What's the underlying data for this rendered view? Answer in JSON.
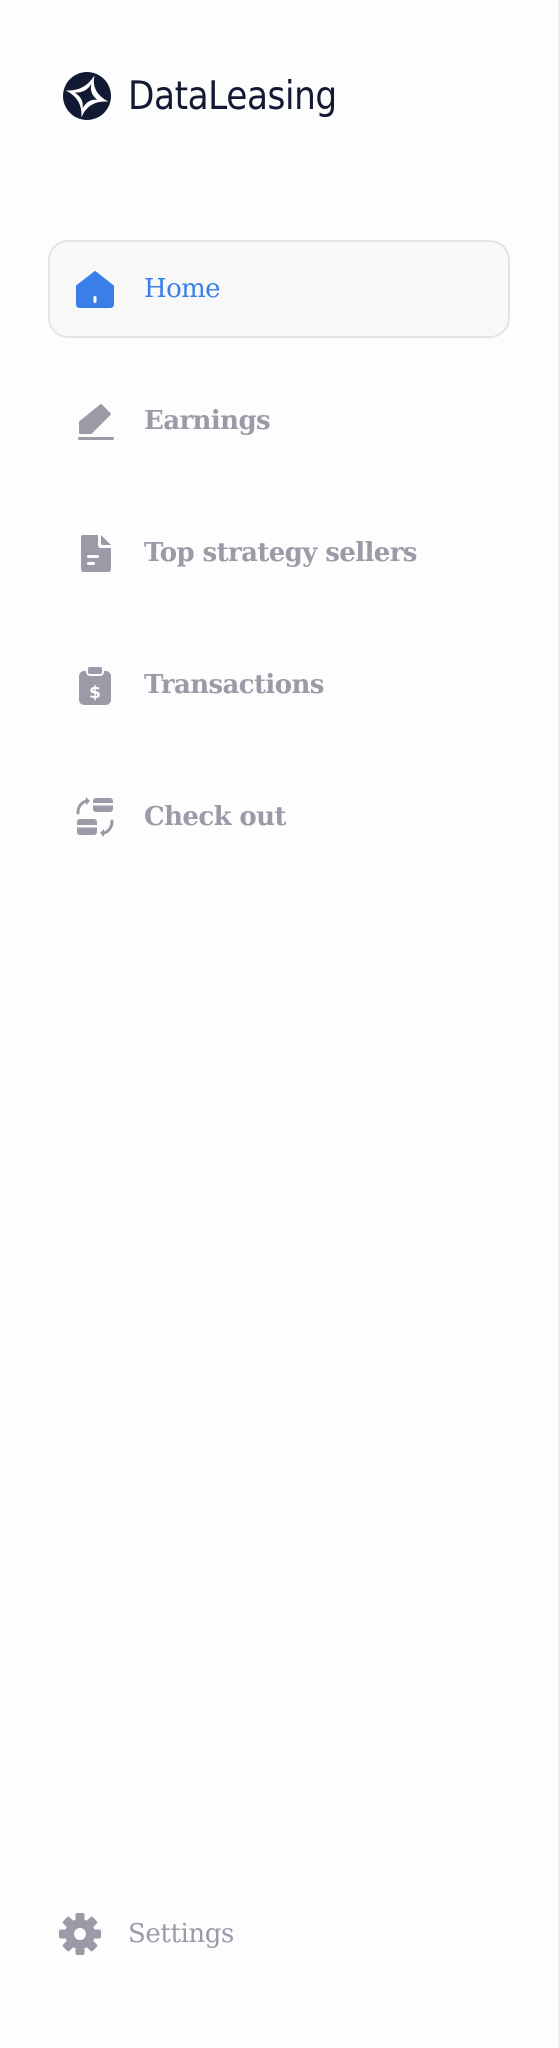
{
  "app": {
    "name": "DataLeasing",
    "logo_icon": "star-burst-logo-icon"
  },
  "colors": {
    "accent": "#3a7fe8",
    "inactive": "#9a9ba7",
    "brand_text": "#121a33"
  },
  "nav": {
    "items": [
      {
        "label": "Home",
        "icon": "home-icon",
        "active": true
      },
      {
        "label": "Earnings",
        "icon": "pencil-icon",
        "active": false
      },
      {
        "label": "Top strategy sellers",
        "icon": "document-icon",
        "active": false
      },
      {
        "label": "Transactions",
        "icon": "clipboard-dollar-icon",
        "active": false
      },
      {
        "label": "Check out",
        "icon": "card-exchange-icon",
        "active": false
      }
    ]
  },
  "footer": {
    "settings_label": "Settings",
    "settings_icon": "gear-icon"
  }
}
